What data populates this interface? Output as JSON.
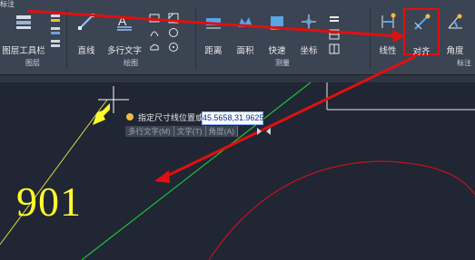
{
  "ribbon": {
    "title": "标注",
    "panels": {
      "layer": "图层",
      "draw": "绘图",
      "measure": "测量",
      "annotation": "标注"
    },
    "tools": {
      "layer_toolbar": "图层工具栏",
      "line": "直线",
      "mtext": "多行文字",
      "distance": "距离",
      "area": "面积",
      "quick": "快速",
      "coordinate": "坐标",
      "linear": "线性",
      "aligned": "对齐",
      "angle": "角度"
    }
  },
  "command": {
    "prompt": "指定尺寸线位置或",
    "coordinate_value": "45.5658,31.9625",
    "options": [
      "多行文字(M)",
      "文字(T)",
      "角度(A)"
    ]
  },
  "drawing": {
    "dimension_text": "901"
  },
  "colors": {
    "highlight": "#ff0000",
    "dimension": "#ffff2e",
    "green_line": "#1fbf3a",
    "arc": "#c0141f"
  }
}
